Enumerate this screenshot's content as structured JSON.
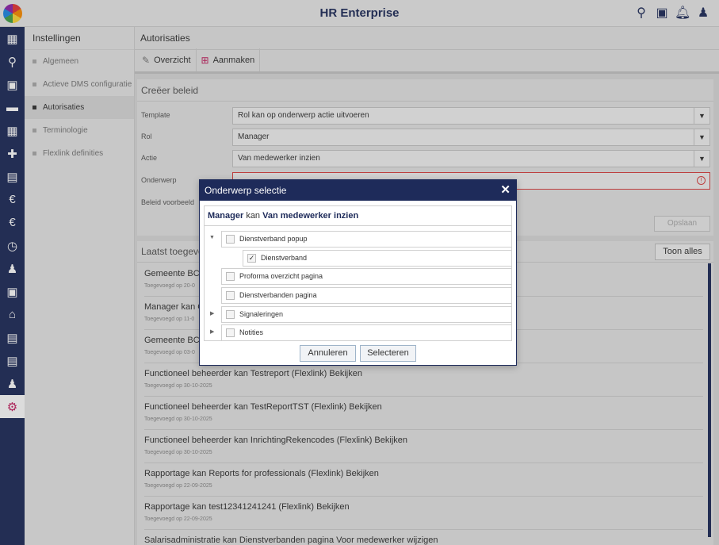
{
  "app": {
    "title": "HR Enterprise"
  },
  "topbar": {
    "icons": [
      "search-person-icon",
      "calendar-person-icon",
      "bell-icon",
      "user-icon"
    ]
  },
  "rail": {
    "items": [
      {
        "icon": "dashboard-icon",
        "glyph": "▦"
      },
      {
        "icon": "search-icon",
        "glyph": "⚲"
      },
      {
        "icon": "id-card-icon",
        "glyph": "▣"
      },
      {
        "icon": "folder-icon",
        "glyph": "▬"
      },
      {
        "icon": "calendar-icon",
        "glyph": "▦"
      },
      {
        "icon": "medical-kit-icon",
        "glyph": "✚"
      },
      {
        "icon": "document-search-icon",
        "glyph": "▤"
      },
      {
        "icon": "money-bag-icon",
        "glyph": "€"
      },
      {
        "icon": "euro-circle-icon",
        "glyph": "€"
      },
      {
        "icon": "calendar-clock-icon",
        "glyph": "◷"
      },
      {
        "icon": "person-edit-icon",
        "glyph": "♟"
      },
      {
        "icon": "contact-card-icon",
        "glyph": "▣"
      },
      {
        "icon": "bank-icon",
        "glyph": "⌂"
      },
      {
        "icon": "document-icon",
        "glyph": "▤"
      },
      {
        "icon": "document-list-icon",
        "glyph": "▤"
      },
      {
        "icon": "person-coin-icon",
        "glyph": "♟"
      },
      {
        "icon": "settings-gear-icon",
        "glyph": "⚙"
      }
    ]
  },
  "settings": {
    "title": "Instellingen",
    "items": [
      "Algemeen",
      "Actieve DMS configuratie",
      "Autorisaties",
      "Terminologie",
      "Flexlink definities"
    ]
  },
  "main": {
    "title": "Autorisaties",
    "tabs": [
      {
        "label": "Overzicht",
        "icon": "edit-icon"
      },
      {
        "label": "Aanmaken",
        "icon": "add-icon"
      }
    ]
  },
  "form": {
    "title": "Creëer beleid",
    "template_label": "Template",
    "template_value": "Rol kan op onderwerp actie uitvoeren",
    "rol_label": "Rol",
    "rol_value": "Manager",
    "actie_label": "Actie",
    "actie_value": "Van medewerker inzien",
    "onderwerp_label": "Onderwerp",
    "onderwerp_value": "",
    "voorbeeld_label": "Beleid voorbeeld",
    "save_label": "Opslaan"
  },
  "recent": {
    "title": "Laatst toegevoegd",
    "show_all_label": "Toon alles",
    "items": [
      {
        "title": "Gemeente BCS",
        "sub": "Toegevoegd op 20-0"
      },
      {
        "title": "Manager kan C",
        "sub": "Toegevoegd op 11-0"
      },
      {
        "title": "Gemeente BCS",
        "sub": "Toegevoegd op 03-0"
      },
      {
        "title": "Functioneel beheerder kan Testreport (Flexlink) Bekijken",
        "sub": "Toegevoegd op 30-10-2025"
      },
      {
        "title": "Functioneel beheerder kan TestReportTST (Flexlink) Bekijken",
        "sub": "Toegevoegd op 30-10-2025"
      },
      {
        "title": "Functioneel beheerder kan InrichtingRekencodes (Flexlink) Bekijken",
        "sub": "Toegevoegd op 30-10-2025"
      },
      {
        "title": "Rapportage kan Reports for professionals (Flexlink) Bekijken",
        "sub": "Toegevoegd op 22-09-2025"
      },
      {
        "title": "Rapportage kan test12341241241 (Flexlink) Bekijken",
        "sub": "Toegevoegd op 22-09-2025"
      },
      {
        "title": "Salarisadministratie kan Dienstverbanden pagina Voor medewerker wijzigen",
        "sub": ""
      }
    ]
  },
  "modal": {
    "title": "Onderwerp selectie",
    "close_glyph": "✕",
    "subject_role": "Manager",
    "subject_join": "kan",
    "subject_action": "Van medewerker inzien",
    "tree": [
      {
        "label": "Dienstverband popup",
        "toggle": "▼",
        "checked": false
      },
      {
        "label": "Dienstverband",
        "toggle": "",
        "checked": true
      },
      {
        "label": "Proforma overzicht pagina",
        "toggle": "",
        "checked": false
      },
      {
        "label": "Dienstverbanden pagina",
        "toggle": "",
        "checked": false
      },
      {
        "label": "Signaleringen",
        "toggle": "▶",
        "checked": false
      },
      {
        "label": "Notities",
        "toggle": "▶",
        "checked": false
      }
    ],
    "cancel_label": "Annuleren",
    "select_label": "Selecteren"
  }
}
